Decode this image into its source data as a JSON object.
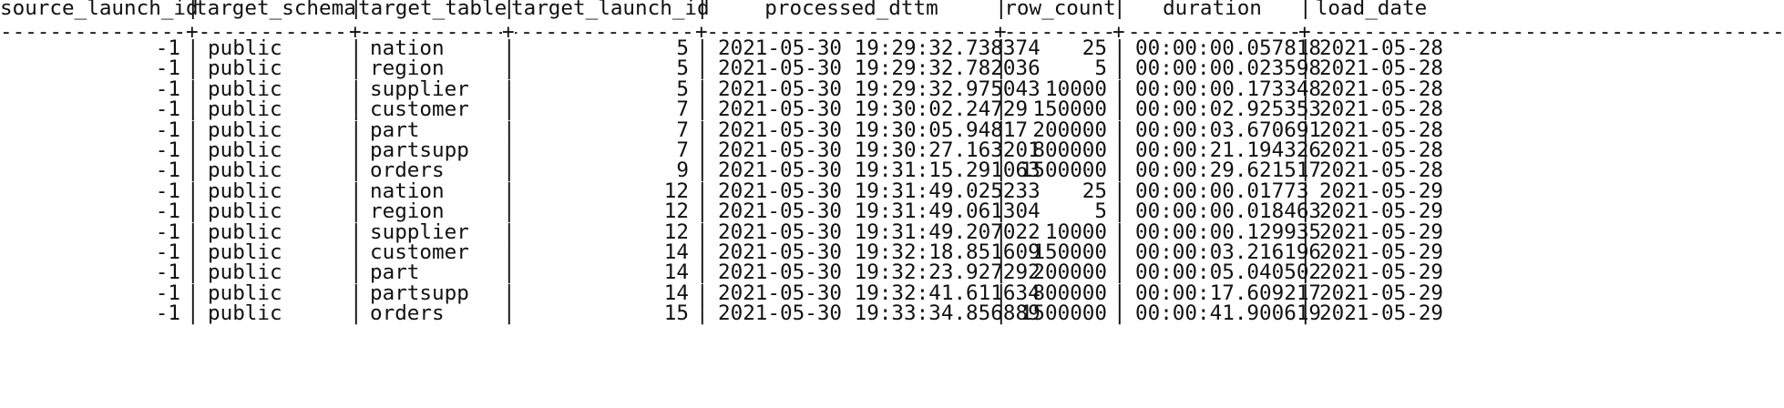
{
  "separator": "|",
  "plus": "+",
  "dash": "-",
  "columns": [
    {
      "key": "source_launch_id",
      "header": "source_launch_id",
      "align": "r"
    },
    {
      "key": "target_schema",
      "header": "target_schema",
      "align": "l"
    },
    {
      "key": "target_table",
      "header": "target_table",
      "align": "l"
    },
    {
      "key": "target_launch_id",
      "header": "target_launch_id",
      "align": "r"
    },
    {
      "key": "processed_dttm",
      "header": "processed_dttm",
      "align": "l"
    },
    {
      "key": "row_count",
      "header": "row_count",
      "align": "r"
    },
    {
      "key": "duration",
      "header": "duration",
      "align": "l"
    },
    {
      "key": "load_date",
      "header": "load_date",
      "align": "l"
    }
  ],
  "rows": [
    [
      "-1",
      "public",
      "nation",
      "5",
      "2021-05-30 19:29:32.738374",
      "25",
      "00:00:00.057818",
      "2021-05-28"
    ],
    [
      "-1",
      "public",
      "region",
      "5",
      "2021-05-30 19:29:32.782036",
      "5",
      "00:00:00.023598",
      "2021-05-28"
    ],
    [
      "-1",
      "public",
      "supplier",
      "5",
      "2021-05-30 19:29:32.975043",
      "10000",
      "00:00:00.173348",
      "2021-05-28"
    ],
    [
      "-1",
      "public",
      "customer",
      "7",
      "2021-05-30 19:30:02.24729",
      "150000",
      "00:00:02.925353",
      "2021-05-28"
    ],
    [
      "-1",
      "public",
      "part",
      "7",
      "2021-05-30 19:30:05.94817",
      "200000",
      "00:00:03.670691",
      "2021-05-28"
    ],
    [
      "-1",
      "public",
      "partsupp",
      "7",
      "2021-05-30 19:30:27.163201",
      "800000",
      "00:00:21.194326",
      "2021-05-28"
    ],
    [
      "-1",
      "public",
      "orders",
      "9",
      "2021-05-30 19:31:15.291063",
      "1500000",
      "00:00:29.621517",
      "2021-05-28"
    ],
    [
      "-1",
      "public",
      "nation",
      "12",
      "2021-05-30 19:31:49.025233",
      "25",
      "00:00:00.01773",
      "2021-05-29"
    ],
    [
      "-1",
      "public",
      "region",
      "12",
      "2021-05-30 19:31:49.061304",
      "5",
      "00:00:00.018463",
      "2021-05-29"
    ],
    [
      "-1",
      "public",
      "supplier",
      "12",
      "2021-05-30 19:31:49.207022",
      "10000",
      "00:00:00.129935",
      "2021-05-29"
    ],
    [
      "-1",
      "public",
      "customer",
      "14",
      "2021-05-30 19:32:18.851609",
      "150000",
      "00:00:03.216196",
      "2021-05-29"
    ],
    [
      "-1",
      "public",
      "part",
      "14",
      "2021-05-30 19:32:23.927292",
      "200000",
      "00:00:05.040502",
      "2021-05-29"
    ],
    [
      "-1",
      "public",
      "partsupp",
      "14",
      "2021-05-30 19:32:41.611634",
      "800000",
      "00:00:17.609217",
      "2021-05-29"
    ],
    [
      "-1",
      "public",
      "orders",
      "15",
      "2021-05-30 19:33:34.856889",
      "1500000",
      "00:00:41.900619",
      "2021-05-29"
    ]
  ]
}
